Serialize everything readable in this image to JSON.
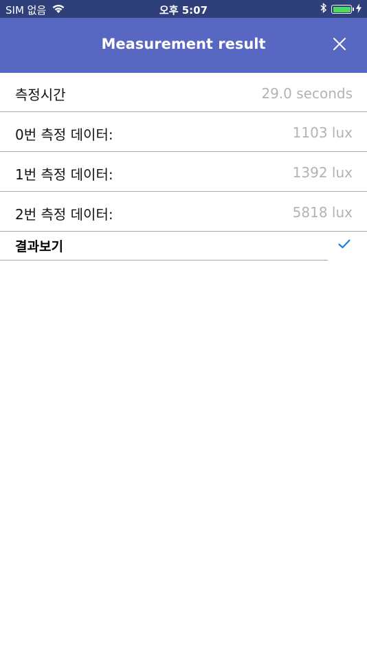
{
  "status_bar": {
    "carrier": "SIM 없음",
    "time": "오후 5:07",
    "wifi_icon": "wifi-icon",
    "bluetooth_icon": "bluetooth-icon",
    "battery_icon": "battery-icon",
    "charging_icon": "charging-bolt-icon",
    "battery_level": 1.0
  },
  "nav": {
    "title": "Measurement result",
    "close_icon": "close-icon",
    "background_color": "#5867c2"
  },
  "rows": [
    {
      "label": "측정시간",
      "value": "29.0 seconds"
    },
    {
      "label": "0번 측정 데이터:",
      "value": "1103 lux"
    },
    {
      "label": "1번 측정 데이터:",
      "value": "1392 lux"
    },
    {
      "label": "2번 측정 데이터:",
      "value": "5818 lux"
    }
  ],
  "result": {
    "label": "결과보기",
    "check_icon": "checkmark-icon",
    "check_color": "#1a7fe8"
  }
}
